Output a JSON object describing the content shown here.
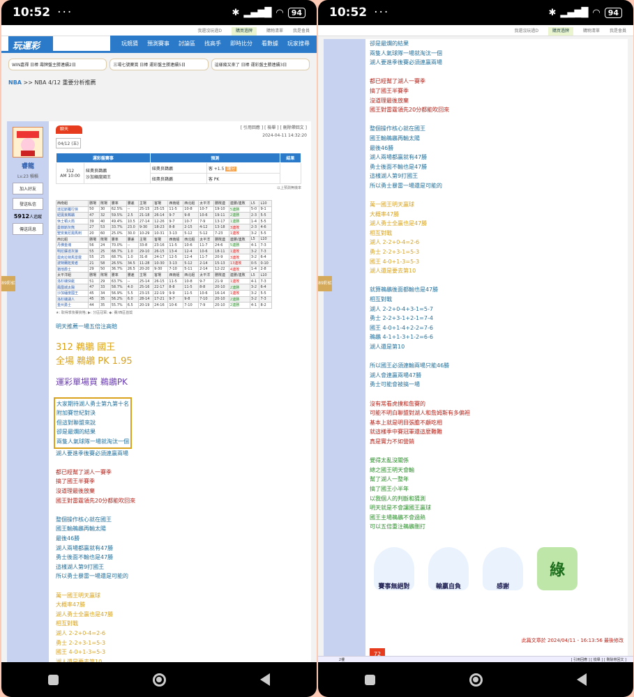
{
  "status": {
    "time": "10:52",
    "dots": "···",
    "battery": "94"
  },
  "topbar": {
    "left": "我還沒玩過D",
    "active": "購買過牌",
    "mid": "購物清單",
    "right": "我是會員"
  },
  "header": {
    "logo": "玩運彩",
    "menu": [
      "玩競猜",
      "預測賽事",
      "討論區",
      "找高手",
      "即時比分",
      "看數據",
      "玩家搜尋"
    ]
  },
  "promos": [
    "WIN嘉禪 日棒 壽牌盤主勝連續2日",
    "三場七號賽賞 日棒 運彩盤主勝連續5日",
    "這樣幾又來了 日棒 運彩盤主勝連續3日"
  ],
  "breadcrumb": {
    "sport": "NBA",
    "rest": ">> NBA 4/12 重要分析推薦"
  },
  "user": {
    "name": "睿龍",
    "level": "Lv.23",
    "level_label": "積積",
    "follow": "加入好友",
    "mail": "發送私信",
    "fans": "5912",
    "fans_label": "人追蹤",
    "msg": "傳送訊息"
  },
  "post": {
    "badge": "聊天",
    "links": "[ 引用回應 ] [ 檢舉 ] [ 刪除帶回文 ]",
    "time": "2024-04-11 14:32:20",
    "date": "04/12 (五)"
  },
  "game_table": {
    "h1": "運彩盤賽事",
    "h2": "預測",
    "h3": "結果",
    "game_no": "312",
    "game_time": "AM 10:00",
    "team1": "紐奧良鵜鶘",
    "team2": "沙加緬度國王",
    "pick1": "紐奧良鵜鶘",
    "pick1_odds": "客 +1.5",
    "pick1_tag": "讓分",
    "pick2": "紐奧良鵜鶘",
    "pick2_odds": "客 PK",
    "footnote": "以上預測無機率"
  },
  "grid": [
    [
      "西南組",
      "勝場",
      "敗場",
      "勝率",
      "勝差",
      "主場",
      "客場",
      "西南組",
      "西北組",
      "太平洋",
      "勝敗連",
      "連勝/連敗",
      "L5",
      "L10"
    ],
    [
      "達拉斯獨行俠",
      "50",
      "30",
      "62.5%",
      "--",
      "25-15",
      "25-15",
      "11-5",
      "10-8",
      "10-7",
      "19-10",
      "5連勝",
      "5-0",
      "9-1"
    ],
    [
      "紐奧良鵜鶘",
      "47",
      "32",
      "59.5%",
      "2.5",
      "21-18",
      "26-14",
      "9-7",
      "9-8",
      "10-6",
      "19-11",
      "2連勝",
      "2-3",
      "5-5"
    ],
    [
      "休士頓火箭",
      "39",
      "40",
      "49.4%",
      "10.5",
      "27-14",
      "12-26",
      "9-7",
      "10-7",
      "7-9",
      "13-17",
      "1連勝",
      "1-4",
      "5-5"
    ],
    [
      "曼菲斯灰熊",
      "27",
      "53",
      "33.7%",
      "23.0",
      "9-30",
      "18-23",
      "8-8",
      "2-15",
      "4-12",
      "13-18",
      "3連敗",
      "2-3",
      "4-6"
    ],
    [
      "聖安東尼奧馬刺",
      "20",
      "60",
      "25.0%",
      "30.0",
      "10-29",
      "10-31",
      "3-13",
      "5-12",
      "5-12",
      "7-23",
      "1連敗",
      "3-2",
      "5-5"
    ],
    [
      "西北組",
      "勝場",
      "敗場",
      "勝率",
      "勝差",
      "主場",
      "客場",
      "西南組",
      "西北組",
      "太平洋",
      "勝敗連",
      "連勝/連敗",
      "L5",
      "L10"
    ],
    [
      "丹佛金塊",
      "56",
      "24",
      "70.0%",
      "--",
      "33-8",
      "23-16",
      "11-5",
      "10-6",
      "11-7",
      "24-6",
      "5連勝",
      "4-1",
      "7-3"
    ],
    [
      "明尼蘇達灰狼",
      "55",
      "25",
      "68.7%",
      "1.0",
      "29-10",
      "26-15",
      "13-4",
      "12-4",
      "10-6",
      "18-11",
      "1連敗",
      "3-2",
      "7-3"
    ],
    [
      "奧克拉荷馬雷霆",
      "55",
      "25",
      "68.7%",
      "1.0",
      "31-8",
      "24-17",
      "12-5",
      "12-4",
      "11-7",
      "20-9",
      "3連敗",
      "3-2",
      "6-4"
    ],
    [
      "波特蘭拓荒者",
      "21",
      "58",
      "26.5%",
      "34.5",
      "11-28",
      "10-30",
      "3-13",
      "5-12",
      "2-14",
      "15-13",
      "13連敗",
      "0-5",
      "0-10"
    ],
    [
      "猶他爵士",
      "29",
      "50",
      "36.7%",
      "26.5",
      "20-20",
      "9-30",
      "7-10",
      "5-11",
      "2-14",
      "12-22",
      "4連敗",
      "1-4",
      "2-8"
    ],
    [
      "太平洋組",
      "勝場",
      "敗場",
      "勝率",
      "勝差",
      "主場",
      "客場",
      "西南組",
      "西北組",
      "太平洋",
      "勝敗連",
      "連勝/連敗",
      "L5",
      "L10"
    ],
    [
      "洛杉磯快艇",
      "51",
      "29",
      "63.7%",
      "--",
      "25-14",
      "26-15",
      "11-5",
      "10-8",
      "9-7",
      "21-9",
      "1連敗",
      "4-1",
      "7-3"
    ],
    [
      "鳳凰城太陽",
      "47",
      "33",
      "58.7%",
      "4.0",
      "25-16",
      "22-17",
      "8-8",
      "11-5",
      "8-8",
      "20-10",
      "2連勝",
      "3-2",
      "6-4"
    ],
    [
      "沙加緬度國王",
      "45",
      "34",
      "56.9%",
      "5.5",
      "23-15",
      "22-19",
      "9-9",
      "11-5",
      "10-6",
      "16-14",
      "1連敗",
      "3-2",
      "5-5"
    ],
    [
      "洛杉磯湖人",
      "45",
      "35",
      "56.2%",
      "6.0",
      "28-14",
      "17-21",
      "9-7",
      "9-8",
      "7-10",
      "20-10",
      "2連勝",
      "3-2",
      "7-3"
    ],
    [
      "金州勇士",
      "44",
      "35",
      "55.7%",
      "6.5",
      "20-19",
      "24-16",
      "10-6",
      "7-10",
      "7-9",
      "20-10",
      "2連勝",
      "4-1",
      "8-2"
    ]
  ],
  "grid_note": "★: 取得季後賽資格; ▶: 分區冠軍; ◆: 賽/西區首獎",
  "p1_lines": [
    [
      "明天推薦一場五倍注高賠",
      "b"
    ],
    [
      "",
      ""
    ],
    [
      "312  鵜鶘  國王",
      "big"
    ],
    [
      "全場 鵜鶘 PK 1.95",
      "big"
    ],
    [
      "",
      ""
    ],
    [
      "運彩單場買 鵜鶘PK",
      "bigp"
    ],
    [
      "",
      ""
    ]
  ],
  "p1_hl": [
    "大家期待湖人勇士第九第十名",
    "附加賽世紀對決",
    "但這對聯盟來說",
    "卻是最爛的結果",
    "兩隻人氣球隊一場就淘汰一個"
  ],
  "p1_rest": [
    [
      "湖人要進季後賽必須連贏兩場",
      "b"
    ],
    [
      "",
      ""
    ],
    [
      "都已經幫了湖人一賽季",
      "r"
    ],
    [
      "搞了國王半賽季",
      "r"
    ],
    [
      "沒道理最後放棄",
      "r"
    ],
    [
      "國王對雷霆領先20分都能吹回來",
      "r"
    ],
    [
      "",
      ""
    ],
    [
      "整個操作核心就在國王",
      "b"
    ],
    [
      "國王輸鵜鶘再輸太陽",
      "b"
    ],
    [
      "最後46勝",
      "b"
    ],
    [
      "湖人兩場都贏就有47勝",
      "b"
    ],
    [
      "勇士後面不輸也是47勝",
      "b"
    ],
    [
      "這樣湖人第9打國王",
      "b"
    ],
    [
      "所以勇士暴雷一場還是可能的",
      "b"
    ],
    [
      "",
      ""
    ],
    [
      "萬一國王明天贏球",
      "o"
    ],
    [
      "大概率47勝",
      "o"
    ],
    [
      "湖人勇士全贏也是47勝",
      "o"
    ],
    [
      "相互對戰",
      "o"
    ],
    [
      "湖人 2-2+0-4=2-6",
      "o"
    ],
    [
      "勇士 2-2+3-1=5-3",
      "o"
    ],
    [
      "國王 4-0+1-3=5-3",
      "o"
    ],
    [
      "湖人還是要去第10",
      "o"
    ],
    [
      "",
      ""
    ],
    [
      "就算鵜鶘後面都輸也是47勝",
      "o"
    ]
  ],
  "p2_lines": [
    [
      "卻是最爛的結果",
      "b"
    ],
    [
      "兩隻人氣球隊一場就淘汰一個",
      "b"
    ],
    [
      "湖人要進季後賽必須連贏兩場",
      "b"
    ],
    [
      "",
      ""
    ],
    [
      "都已經幫了湖人一賽季",
      "r"
    ],
    [
      "搞了國王半賽季",
      "r"
    ],
    [
      "沒道理最後放棄",
      "r"
    ],
    [
      "國王對雷霆領先20分都能吹回來",
      "r"
    ],
    [
      "",
      ""
    ],
    [
      "整個操作核心就在國王",
      "b"
    ],
    [
      "國王輸鵜鶘再輸太陽",
      "b"
    ],
    [
      "最後46勝",
      "b"
    ],
    [
      "湖人兩場都贏就有47勝",
      "b"
    ],
    [
      "勇士後面不輸也是47勝",
      "b"
    ],
    [
      "這樣湖人第9打國王",
      "b"
    ],
    [
      "所以勇士暴雷一場還是可能的",
      "b"
    ],
    [
      "",
      ""
    ],
    [
      "萬一國王明天贏球",
      "o"
    ],
    [
      "大概率47勝",
      "o"
    ],
    [
      "湖人勇士全贏也是47勝",
      "o"
    ],
    [
      "相互對戰",
      "o"
    ],
    [
      "湖人 2-2+0-4=2-6",
      "o"
    ],
    [
      "勇士 2-2+3-1=5-3",
      "o"
    ],
    [
      "國王 4-0+1-3=5-3",
      "o"
    ],
    [
      "湖人還是要去第10",
      "o"
    ],
    [
      "",
      ""
    ],
    [
      "就算鵜鶘後面都輸也是47勝",
      "b"
    ],
    [
      "相互對戰",
      "b"
    ],
    [
      "湖人 2-2+0-4+3-1=5-7",
      "b"
    ],
    [
      "勇士 2-2+3-1+2-1=7-4",
      "b"
    ],
    [
      "國王 4-0+1-4+2-2=7-6",
      "b"
    ],
    [
      "鵜鶘 4-1+1-3+1-2=6-6",
      "b"
    ],
    [
      "湖人還是第10",
      "b"
    ],
    [
      "",
      ""
    ],
    [
      "所以國王必須連輸兩場只能46勝",
      "b"
    ],
    [
      "湖人會連贏兩場47勝",
      "b"
    ],
    [
      "勇士可能會被搞一場",
      "b"
    ],
    [
      "",
      ""
    ],
    [
      "沒有常看虎撲和詹賽的",
      "r"
    ],
    [
      "可能不明白聯盟對湖人和詹姆斯有多偏袒",
      "r"
    ],
    [
      "基本上就是明目張膽不顧吃相",
      "r"
    ],
    [
      "就這樣季中賽冠軍還這麼難難",
      "r"
    ],
    [
      "真是實力不如營銷",
      "r"
    ],
    [
      "",
      ""
    ],
    [
      "覺得太亂沒關係",
      "g"
    ],
    [
      "總之國王明天會輸",
      "g"
    ],
    [
      "幫了湖人一整年",
      "g"
    ],
    [
      "搞了國王小半年",
      "g"
    ],
    [
      "以我個人的判斷和猜測",
      "g"
    ],
    [
      "明天就是不會讓國王贏球",
      "g"
    ],
    [
      "國王主場鵜鶘不會過熱",
      "g"
    ],
    [
      "可以五倍重注鵜鶘刪打",
      "g"
    ]
  ],
  "stickers": [
    "賽事無絕對",
    "輸贏自負",
    "感謝",
    "綠"
  ],
  "edit_note": "此篇文章於 2024/04/11 - 16:13:56 最後修改",
  "floor": {
    "label": "2樓",
    "links": "[ 引用回應 ] [ 檢舉 ] [ 刪除帶回文 ]",
    "badge": "72"
  },
  "ad_label": "89彩虹"
}
